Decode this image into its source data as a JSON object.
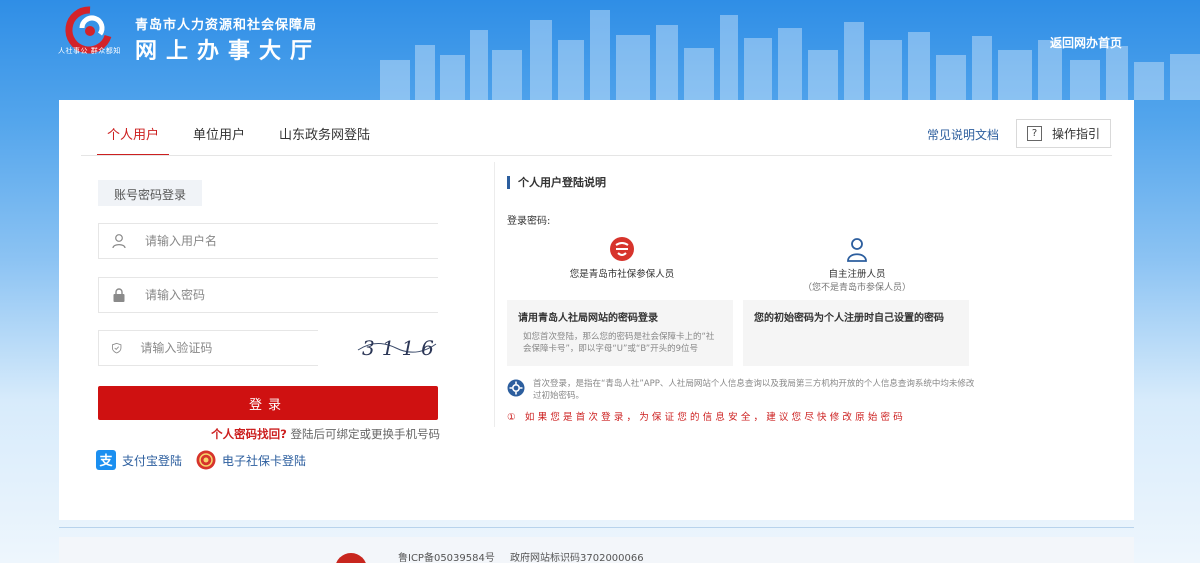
{
  "header": {
    "logo_slogan": "人社事公 群众都知",
    "org_name": "青岛市人力资源和社会保障局",
    "hall_name": "网上办事大厅",
    "home_link": "返回网办首页"
  },
  "tabs": [
    {
      "label": "个人用户",
      "active": true
    },
    {
      "label": "单位用户",
      "active": false
    },
    {
      "label": "山东政务网登陆",
      "active": false
    }
  ],
  "toolbar": {
    "doc_link": "常见说明文档",
    "guide_label": "操作指引",
    "guide_icon": "?"
  },
  "login": {
    "mode_label": "账号密码登录",
    "username_placeholder": "请输入用户名",
    "password_placeholder": "请输入密码",
    "code_placeholder": "请输入验证码",
    "captcha_text": "3116",
    "login_label": "登录",
    "recover_link": "个人密码找回?",
    "recover_hint": "登陆后可绑定或更换手机号码",
    "third_party": [
      {
        "label": "支付宝登陆",
        "icon": "alipay-icon"
      },
      {
        "label": "电子社保卡登陆",
        "icon": "social-card-icon"
      }
    ]
  },
  "info": {
    "title": "个人用户登陆说明",
    "label": "登录密码:",
    "option1": {
      "label": "您是青岛市社保参保人员",
      "icon": "social-security-icon"
    },
    "option2": {
      "label": "自主注册人员",
      "sub": "（您不是青岛市参保人员）",
      "icon": "person-icon"
    },
    "box1": {
      "title": "请用青岛人社局网站的密码登录",
      "desc": "如您首次登陆，那么您的密码是社会保障卡上的“社会保障卡号”，即以字母“U”或“B”开头的9位号"
    },
    "box2": {
      "title": "您的初始密码为个人注册时自己设置的密码"
    },
    "note": "首次登录，是指在“青岛人社”APP、人社局网站个人信息查询以及我局第三方机构开放的个人信息查询系统中均未修改过初始密码。",
    "warning": "① 如果您是首次登录，为保证您的信息安全，建议您尽快修改原始密码"
  },
  "footer": {
    "icp": "鲁ICP备05039584号",
    "gov": "政府网站标识码3702000066"
  },
  "colors": {
    "accent_red": "#cf1111",
    "link_blue": "#2c5e9e"
  }
}
